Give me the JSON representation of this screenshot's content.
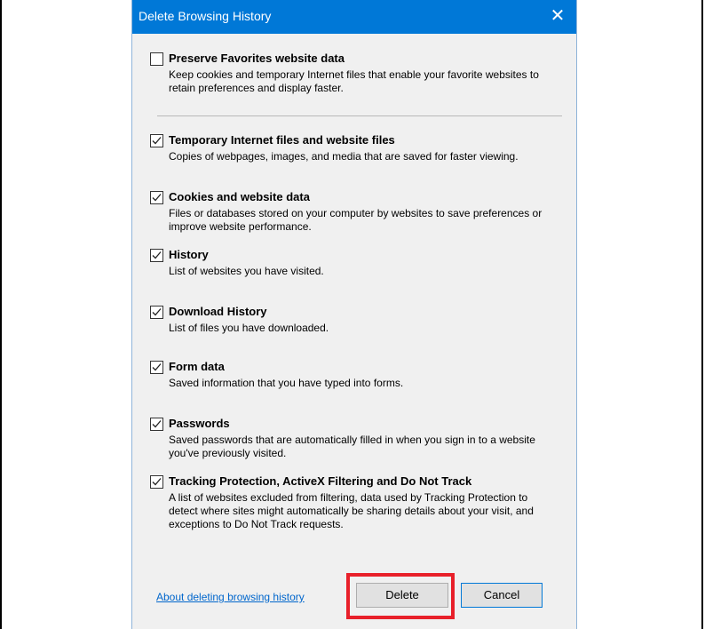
{
  "dialog": {
    "title": "Delete Browsing History",
    "close_glyph": "✕"
  },
  "options": [
    {
      "label": "Preserve Favorites website data",
      "checked": false,
      "description": "Keep cookies and temporary Internet files that enable your favorite websites to retain preferences and display faster."
    },
    {
      "label": "Temporary Internet files and website files",
      "checked": true,
      "description": "Copies of webpages, images, and media that are saved for faster viewing."
    },
    {
      "label": "Cookies and website data",
      "checked": true,
      "description": "Files or databases stored on your computer by websites to save preferences or improve website performance."
    },
    {
      "label": "History",
      "checked": true,
      "description": "List of websites you have visited."
    },
    {
      "label": "Download History",
      "checked": true,
      "description": "List of files you have downloaded."
    },
    {
      "label": "Form data",
      "checked": true,
      "description": "Saved information that you have typed into forms."
    },
    {
      "label": "Passwords",
      "checked": true,
      "description": "Saved passwords that are automatically filled in when you sign in to a website you've previously visited."
    },
    {
      "label": "Tracking Protection, ActiveX Filtering and Do Not Track",
      "checked": true,
      "description": "A list of websites excluded from filtering, data used by Tracking Protection to detect where sites might automatically be sharing details about your visit, and exceptions to Do Not Track requests."
    }
  ],
  "footer": {
    "link_text": "About deleting browsing history",
    "delete_label": "Delete",
    "cancel_label": "Cancel"
  },
  "colors": {
    "titlebar": "#0078d7",
    "highlight": "#e8202a",
    "link": "#0066cc"
  }
}
